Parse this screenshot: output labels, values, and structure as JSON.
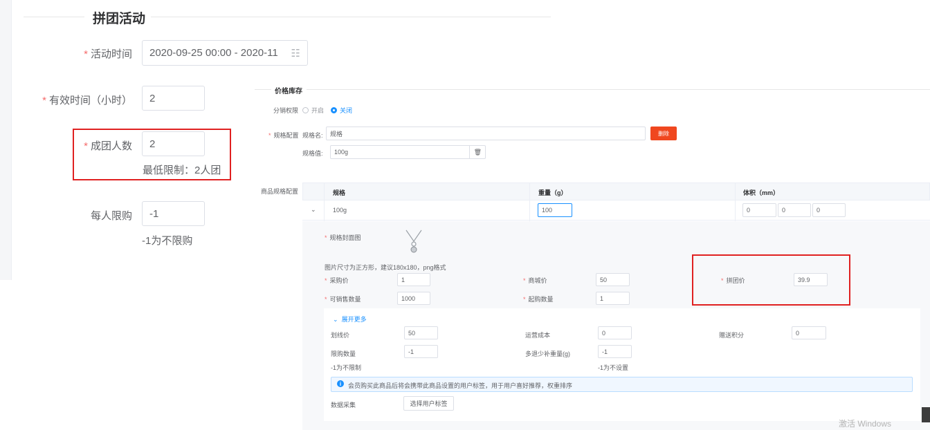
{
  "section": {
    "title": "拼团活动"
  },
  "form": {
    "time": {
      "label": "活动时间",
      "value": "2020-09-25 00:00 - 2020-11"
    },
    "valid_hours": {
      "label": "有效时间（小时）",
      "value": "2"
    },
    "group_size": {
      "label": "成团人数",
      "value": "2",
      "hint": "最低限制：2人团"
    },
    "limit": {
      "label": "每人限购",
      "value": "-1",
      "hint": "-1为不限购"
    }
  },
  "stock": {
    "title": "价格库存",
    "distribution": {
      "label": "分销权限",
      "options": [
        "开启",
        "关闭"
      ],
      "selected": "关闭"
    },
    "spec_config": {
      "label": "规格配置",
      "name_label": "规格名:",
      "name_value": "规格",
      "value_label": "规格值:",
      "value_value": "100g",
      "delete_label": "删除"
    },
    "product_spec_label": "商品规格配置",
    "table": {
      "headers": [
        "规格",
        "重量（g）",
        "体积（mm）"
      ],
      "row": {
        "spec": "100g",
        "weight": "100",
        "volume": [
          "0",
          "0",
          "0"
        ]
      }
    },
    "detail": {
      "cover_label": "规格封面图",
      "cover_hint": "图片尺寸为正方形，建议180x180，png格式",
      "purchase": {
        "label": "采购价",
        "value": "1"
      },
      "mall_price": {
        "label": "商城价",
        "value": "50"
      },
      "group_price": {
        "label": "拼团价",
        "value": "39.9"
      },
      "sellable": {
        "label": "可销售数量",
        "value": "1000"
      },
      "min_buy": {
        "label": "起购数量",
        "value": "1"
      }
    },
    "more": {
      "toggle": "展开更多",
      "strike_price": {
        "label": "划线价",
        "value": "50"
      },
      "shipping_cost": {
        "label": "运营成本",
        "value": "0"
      },
      "points": {
        "label": "赠送积分",
        "value": "0"
      },
      "limit_qty": {
        "label": "限购数量",
        "value": "-1",
        "hint": "-1为不限制"
      },
      "refund_weight": {
        "label": "多退少补重量(g)",
        "value": "-1",
        "hint": "-1为不设置"
      },
      "info": "会员购买此商品后将会携带此商品设置的用户标签，用于用户喜好推荐，权重排序",
      "data_collect": {
        "label": "数据采集",
        "button": "选择用户标签"
      }
    }
  },
  "watermark": "激活 Windows",
  "colors": {
    "accent": "#1890ff",
    "danger": "#f0471f",
    "highlight": "#e02020",
    "required": "#f56c6c"
  }
}
